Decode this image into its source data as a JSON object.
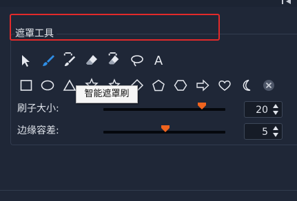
{
  "section": {
    "title": "遮罩工具"
  },
  "tools_row1": [
    {
      "icon": "pointer-icon"
    },
    {
      "icon": "brush-icon",
      "active": true
    },
    {
      "icon": "smart-mask-brush-icon"
    },
    {
      "icon": "eraser-icon"
    },
    {
      "icon": "smart-eraser-icon"
    },
    {
      "icon": "lasso-icon"
    },
    {
      "icon": "text-icon",
      "glyph": "A"
    }
  ],
  "tools_row2": [
    {
      "icon": "rectangle-icon"
    },
    {
      "icon": "ellipse-icon"
    },
    {
      "icon": "triangle-icon"
    },
    {
      "icon": "star-icon"
    },
    {
      "icon": "star-small-icon"
    },
    {
      "icon": "diamond-icon"
    },
    {
      "icon": "pentagon-icon"
    },
    {
      "icon": "hexagon-icon"
    },
    {
      "icon": "arrow-icon"
    },
    {
      "icon": "heart-icon"
    },
    {
      "icon": "crescent-icon"
    },
    {
      "icon": "clear-icon"
    }
  ],
  "tooltip": {
    "text": "智能遮罩刷"
  },
  "brush_size": {
    "label": "刷子大小:",
    "value": "20",
    "slider_fraction": 0.81
  },
  "edge_tolerance": {
    "label": "边缘容差:",
    "value": "5",
    "slider_fraction": 0.51
  },
  "colors": {
    "accent": "#f0641e",
    "highlight_border": "#e32a2a",
    "active_tool": "#2f8ee6",
    "background": "#1f2737"
  }
}
